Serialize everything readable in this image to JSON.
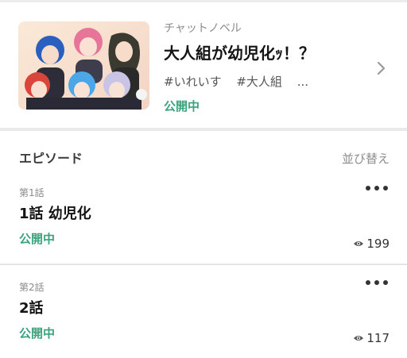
{
  "story": {
    "category": "チャットノベル",
    "title": "大人組が幼児化ｯ！？",
    "tags": [
      "#いれいす",
      "#大人組",
      "..."
    ],
    "status": "公開中"
  },
  "episodes_section": {
    "title": "エピソード",
    "sort_label": "並び替え"
  },
  "episodes": [
    {
      "number": "第1話",
      "title": "1話 幼児化",
      "status": "公開中",
      "views": "199"
    },
    {
      "number": "第2話",
      "title": "2話",
      "status": "公開中",
      "views": "117"
    }
  ],
  "colors": {
    "status_green": "#3aa37c",
    "divider": "#e5e5e5"
  },
  "icons": {
    "chevron": "chevron-right-icon",
    "more": "more-horizontal-icon",
    "views": "eye-icon"
  }
}
